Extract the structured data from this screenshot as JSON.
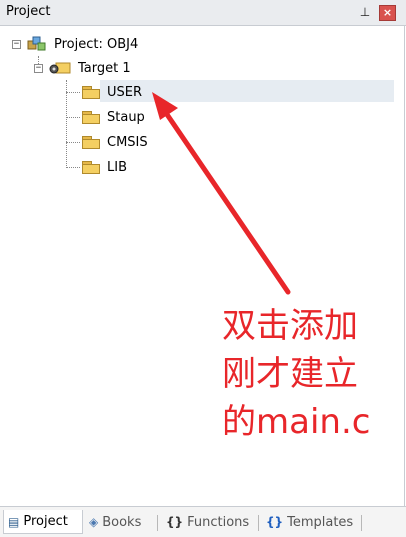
{
  "window": {
    "title": "Project",
    "pin_glyph": "⊥",
    "close_glyph": "×"
  },
  "tree": {
    "project_label": "Project: OBJ4",
    "target_label": "Target 1",
    "folders": [
      {
        "label": "USER",
        "selected": true
      },
      {
        "label": "Staup",
        "selected": false
      },
      {
        "label": "CMSIS",
        "selected": false
      },
      {
        "label": "LIB",
        "selected": false
      }
    ],
    "collapse_glyph": "−"
  },
  "annotation": {
    "lines": [
      "双击添加",
      "刚才建立",
      "的main.c"
    ],
    "color": "#e8262a"
  },
  "tabs": [
    {
      "label": "Project",
      "icon": "project-icon",
      "active": true
    },
    {
      "label": "Books",
      "icon": "books-icon",
      "active": false
    },
    {
      "label": "Functions",
      "icon": "functions-icon",
      "active": false
    },
    {
      "label": "Templates",
      "icon": "templates-icon",
      "active": false
    }
  ],
  "tab_icons": {
    "project": "▤",
    "books": "◈",
    "functions": "{}",
    "templates": "{}"
  }
}
